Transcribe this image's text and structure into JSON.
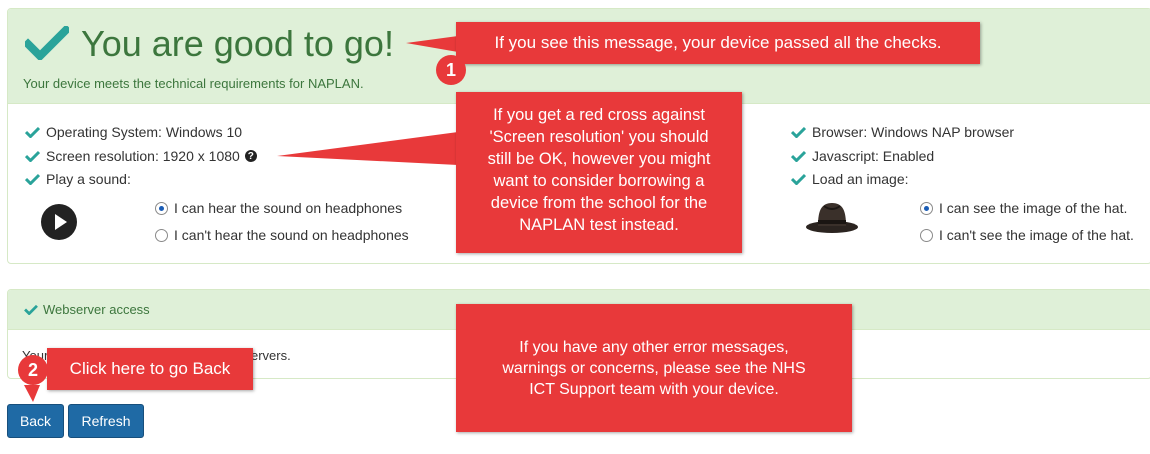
{
  "status_panel": {
    "title": "You are good to go!",
    "subtitle": "Your device meets the technical requirements for NAPLAN.",
    "left_checks": [
      {
        "label": "Operating System: Windows 10"
      },
      {
        "label": "Screen resolution: 1920 x 1080"
      },
      {
        "label": "Play a sound:"
      }
    ],
    "right_checks": [
      {
        "label": "Browser: Windows NAP browser"
      },
      {
        "label": "Javascript: Enabled"
      },
      {
        "label": "Load an image:"
      }
    ],
    "help_glyph": "?",
    "sound_options": [
      {
        "label": "I can hear the sound on headphones",
        "selected": true
      },
      {
        "label": "I can't hear the sound on headphones",
        "selected": false
      }
    ],
    "image_options": [
      {
        "label": "I can see the image of the hat.",
        "selected": true
      },
      {
        "label": "I can't see the image of the hat.",
        "selected": false
      }
    ]
  },
  "webserver_panel": {
    "title": "Webserver access",
    "body_left": "Your",
    "body_right": "ervers."
  },
  "buttons": {
    "back": "Back",
    "refresh": "Refresh"
  },
  "callouts": {
    "passed": {
      "number": "1",
      "text": "If you see this message, your device passed all the checks."
    },
    "resolution": {
      "text": "If you get a red cross against\n'Screen resolution' you should\nstill be OK, however you might\nwant to consider borrowing a\ndevice from the school for the\nNAPLAN test instead."
    },
    "go_back": {
      "number": "2",
      "text": "Click here to go Back"
    },
    "errors": {
      "text": "If you have any other error messages,\nwarnings or concerns, please see the NHS\nICT Support team with your device."
    }
  },
  "colors": {
    "success_bg": "#dff0d8",
    "success_text": "#3c763d",
    "check": "#2aa39a",
    "button": "#1f6aa5",
    "callout": "#e8393a"
  },
  "icons": [
    "check-icon",
    "help-icon",
    "play-icon",
    "hat-image",
    "radio-icon"
  ]
}
